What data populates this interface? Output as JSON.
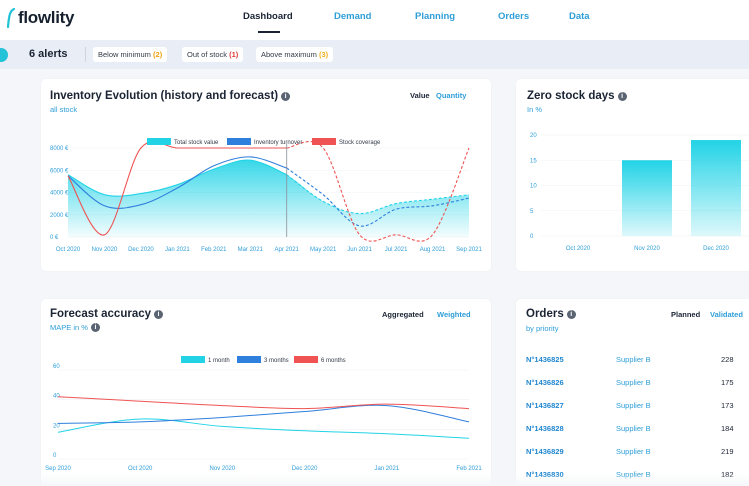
{
  "app": {
    "logo_text": "flowlity"
  },
  "nav": [
    {
      "label": "Dashboard",
      "active": true
    },
    {
      "label": "Demand",
      "active": false
    },
    {
      "label": "Planning",
      "active": false
    },
    {
      "label": "Orders",
      "active": false
    },
    {
      "label": "Data",
      "active": false
    }
  ],
  "alerts": {
    "count_label": "6 alerts",
    "chips": [
      {
        "label": "Below minimum",
        "count": "(2)",
        "color": "#f0a010"
      },
      {
        "label": "Out of stock",
        "count": "(1)",
        "color": "#e03a3a"
      },
      {
        "label": "Above maximum",
        "count": "(3)",
        "color": "#f0b020"
      }
    ]
  },
  "inventory": {
    "title": "Inventory Evolution (history and forecast)",
    "subtitle": "all stock",
    "toggle_on": "Value",
    "toggle_off": "Quantity",
    "legend": [
      "Total stock value",
      "Inventory turnover",
      "Stock coverage"
    ]
  },
  "zero_stock": {
    "title": "Zero stock days",
    "subtitle": "In %"
  },
  "forecast": {
    "title": "Forecast accuracy",
    "subtitle": "MAPE in %",
    "toggle_on": "Aggregated",
    "toggle_off": "Weighted",
    "legend": [
      "1 month",
      "3 months",
      "6 months"
    ]
  },
  "orders": {
    "title": "Orders",
    "subtitle": "by priority",
    "toggle_on": "Planned",
    "toggle_off": "Validated",
    "rows": [
      {
        "id": "N°1436825",
        "supplier": "Supplier B",
        "qty": "228"
      },
      {
        "id": "N°1436826",
        "supplier": "Supplier B",
        "qty": "175"
      },
      {
        "id": "N°1436827",
        "supplier": "Supplier B",
        "qty": "173"
      },
      {
        "id": "N°1436828",
        "supplier": "Supplier B",
        "qty": "184"
      },
      {
        "id": "N°1436829",
        "supplier": "Supplier B",
        "qty": "219"
      },
      {
        "id": "N°1436830",
        "supplier": "Supplier B",
        "qty": "182"
      }
    ]
  },
  "colors": {
    "accent": "#2f9ed8",
    "cyan": "#22d3e6",
    "blue": "#2f7fdc",
    "red": "#ef5353",
    "dark": "#1b2434"
  },
  "chart_data": [
    {
      "type": "area",
      "title": "Inventory Evolution (history and forecast)",
      "categories": [
        "Oct 2020",
        "Nov 2020",
        "Dec 2020",
        "Jan 2021",
        "Feb 2021",
        "Mar 2021",
        "Apr 2021",
        "May 2021",
        "Jun 2021",
        "Jul 2021",
        "Aug 2021",
        "Sep 2021"
      ],
      "y_ticks": [
        "0 €",
        "2000 €",
        "4000 €",
        "6000 €",
        "8000 €"
      ],
      "ylim": [
        0,
        8000
      ],
      "forecast_starts_at": "Apr 2021",
      "series": [
        {
          "name": "Total stock value",
          "values": [
            5600,
            3800,
            3900,
            4700,
            6100,
            6900,
            5600,
            3200,
            2100,
            3000,
            3400,
            3800
          ],
          "color": "#22d3e6"
        },
        {
          "name": "Inventory turnover",
          "values": [
            5500,
            2800,
            2900,
            4400,
            6400,
            7200,
            6200,
            3800,
            1000,
            2500,
            2800,
            3500
          ],
          "color": "#2f7fdc"
        },
        {
          "name": "Stock coverage",
          "values": [
            5500,
            200,
            8000,
            8000,
            8000,
            8000,
            8000,
            8000,
            200,
            200,
            200,
            8000
          ],
          "color": "#ef5353"
        }
      ]
    },
    {
      "type": "bar",
      "title": "Zero stock days",
      "categories": [
        "Oct 2020",
        "Nov 2020",
        "Dec 2020"
      ],
      "values": [
        0,
        15,
        19
      ],
      "y_ticks": [
        "0",
        "5",
        "10",
        "15",
        "20"
      ],
      "ylim": [
        0,
        20
      ]
    },
    {
      "type": "line",
      "title": "Forecast accuracy",
      "categories": [
        "Sep 2020",
        "Oct 2020",
        "Nov 2020",
        "Dec 2020",
        "Jan 2021",
        "Feb 2021"
      ],
      "y_ticks": [
        "0",
        "20",
        "40",
        "60"
      ],
      "ylim": [
        0,
        60
      ],
      "series": [
        {
          "name": "1 month",
          "values": [
            18,
            27,
            22,
            19,
            17,
            14
          ],
          "color": "#22d3e6"
        },
        {
          "name": "3 months",
          "values": [
            24,
            25,
            28,
            32,
            36,
            25
          ],
          "color": "#2f7fdc"
        },
        {
          "name": "6 months",
          "values": [
            42,
            39,
            36,
            34,
            37,
            34
          ],
          "color": "#ef5353"
        }
      ]
    }
  ]
}
